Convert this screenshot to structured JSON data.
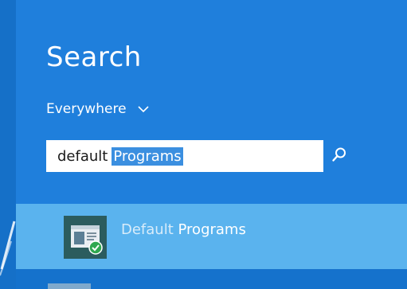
{
  "search": {
    "heading": "Search",
    "scope_label": "Everywhere",
    "query_typed": "default",
    "query_selected": "Programs"
  },
  "results": [
    {
      "label_dim": "Default",
      "label_bold": "Programs",
      "icon": "default-programs-icon"
    }
  ],
  "icons": {
    "search_button": "magnifier-icon",
    "scope_dropdown": "chevron-down-icon"
  },
  "colors": {
    "panel": "#1f7fdc",
    "selected_result": "#5ab3ee",
    "text_selection": "#3b8fe0"
  }
}
